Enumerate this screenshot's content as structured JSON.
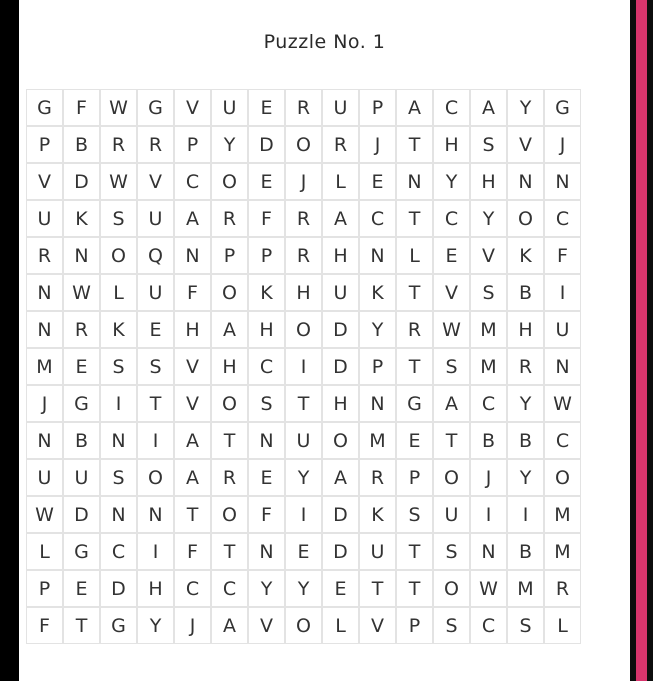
{
  "title": "Puzzle No. 1",
  "colors": {
    "accent": "#d9356d",
    "frame": "#000000",
    "letter": "#333333",
    "cell_border": "#e3e3e3"
  },
  "grid": {
    "rows": [
      [
        "G",
        "F",
        "W",
        "G",
        "V",
        "U",
        "E",
        "R",
        "U",
        "P",
        "A",
        "C",
        "A",
        "Y",
        "G"
      ],
      [
        "P",
        "B",
        "R",
        "R",
        "P",
        "Y",
        "D",
        "O",
        "R",
        "J",
        "T",
        "H",
        "S",
        "V",
        "J"
      ],
      [
        "V",
        "D",
        "W",
        "V",
        "C",
        "O",
        "E",
        "J",
        "L",
        "E",
        "N",
        "Y",
        "H",
        "N",
        "N"
      ],
      [
        "U",
        "K",
        "S",
        "U",
        "A",
        "R",
        "F",
        "R",
        "A",
        "C",
        "T",
        "C",
        "Y",
        "O",
        "C"
      ],
      [
        "R",
        "N",
        "O",
        "Q",
        "N",
        "P",
        "P",
        "R",
        "H",
        "N",
        "L",
        "E",
        "V",
        "K",
        "F"
      ],
      [
        "N",
        "W",
        "L",
        "U",
        "F",
        "O",
        "K",
        "H",
        "U",
        "K",
        "T",
        "V",
        "S",
        "B",
        "I"
      ],
      [
        "N",
        "R",
        "K",
        "E",
        "H",
        "A",
        "H",
        "O",
        "D",
        "Y",
        "R",
        "W",
        "M",
        "H",
        "U"
      ],
      [
        "M",
        "E",
        "S",
        "S",
        "V",
        "H",
        "C",
        "I",
        "D",
        "P",
        "T",
        "S",
        "M",
        "R",
        "N"
      ],
      [
        "J",
        "G",
        "I",
        "T",
        "V",
        "O",
        "S",
        "T",
        "H",
        "N",
        "G",
        "A",
        "C",
        "Y",
        "W"
      ],
      [
        "N",
        "B",
        "N",
        "I",
        "A",
        "T",
        "N",
        "U",
        "O",
        "M",
        "E",
        "T",
        "B",
        "B",
        "C"
      ],
      [
        "U",
        "U",
        "S",
        "O",
        "A",
        "R",
        "E",
        "Y",
        "A",
        "R",
        "P",
        "O",
        "J",
        "Y",
        "O"
      ],
      [
        "W",
        "D",
        "N",
        "N",
        "T",
        "O",
        "F",
        "I",
        "D",
        "K",
        "S",
        "U",
        "I",
        "I",
        "M"
      ],
      [
        "L",
        "G",
        "C",
        "I",
        "F",
        "T",
        "N",
        "E",
        "D",
        "U",
        "T",
        "S",
        "N",
        "B",
        "M"
      ],
      [
        "P",
        "E",
        "D",
        "H",
        "C",
        "C",
        "Y",
        "Y",
        "E",
        "T",
        "T",
        "O",
        "W",
        "M",
        "R"
      ],
      [
        "F",
        "T",
        "G",
        "Y",
        "J",
        "A",
        "V",
        "O",
        "L",
        "V",
        "P",
        "S",
        "C",
        "S",
        "L"
      ]
    ]
  }
}
